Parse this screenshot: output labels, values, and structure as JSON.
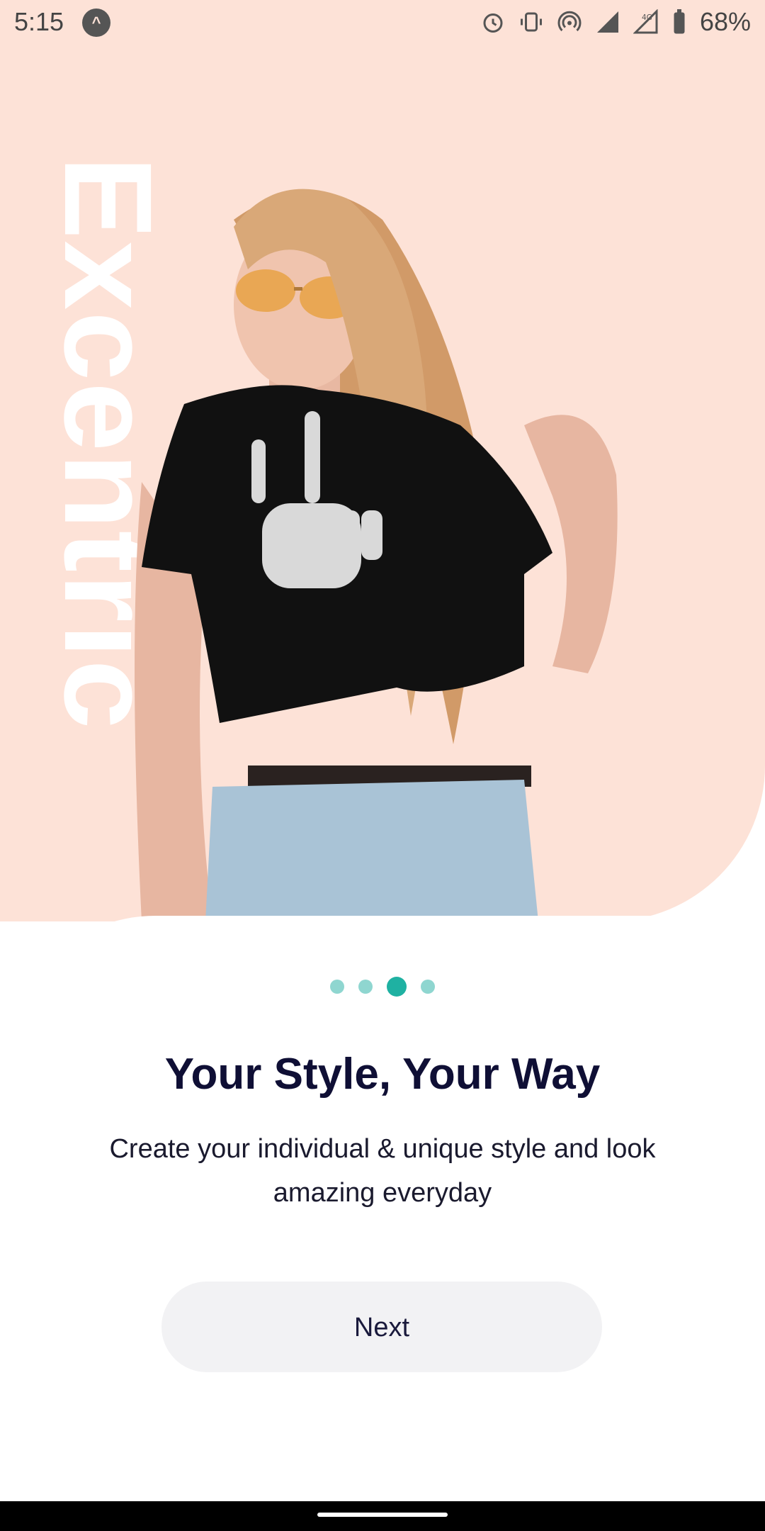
{
  "status": {
    "time": "5:15",
    "battery": "68%",
    "network": "4G"
  },
  "hero": {
    "vertical_text": "Excentric"
  },
  "onboarding": {
    "page_count": 4,
    "current_page": 3,
    "title": "Your Style, Your Way",
    "subtitle": "Create your individual & unique style and look amazing everyday",
    "next_label": "Next"
  },
  "colors": {
    "panel_bg": "#fde2d7",
    "accent": "#1fb1a2",
    "accent_light": "#8fd6d0",
    "title": "#0f0f35",
    "button_bg": "#f2f2f4"
  },
  "icons": [
    "alarm-icon",
    "vibrate-icon",
    "hotspot-icon",
    "signal-icon",
    "battery-icon",
    "app-notification-icon"
  ]
}
